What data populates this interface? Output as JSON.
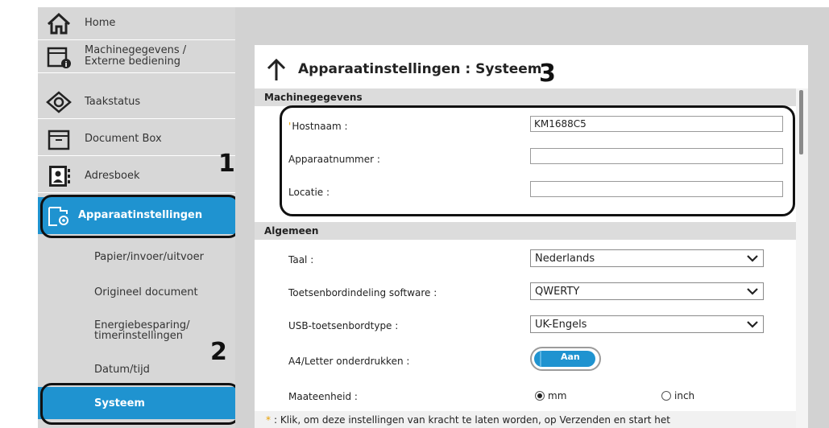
{
  "sidebar": {
    "items": [
      {
        "label": "Home",
        "icon": "home-icon"
      },
      {
        "label_line1": "Machinegegevens /",
        "label_line2": "Externe bediening",
        "icon": "machine-info-icon"
      },
      {
        "label": "Taakstatus",
        "icon": "eye-icon"
      },
      {
        "label": "Document Box",
        "icon": "document-box-icon"
      },
      {
        "label": "Adresboek",
        "icon": "address-book-icon"
      },
      {
        "label": "Apparaatinstellingen",
        "icon": "device-settings-icon",
        "active": true
      }
    ],
    "subitems": [
      {
        "label": "Papier/invoer/uitvoer"
      },
      {
        "label": "Origineel document"
      },
      {
        "label_line1": "Energiebesparing/",
        "label_line2": "timerinstellingen"
      },
      {
        "label": "Datum/tijd"
      },
      {
        "label": "Systeem",
        "active": true
      }
    ]
  },
  "callouts": {
    "n1": "1",
    "n2": "2",
    "n3": "3"
  },
  "panel": {
    "title": "Apparaatinstellingen : Systeem",
    "sections": {
      "machine": {
        "heading": "Machinegegevens",
        "hostname_label": "Hostnaam :",
        "hostname_value": "KM1688C5",
        "device_number_label": "Apparaatnummer :",
        "device_number_value": "",
        "location_label": "Locatie :",
        "location_value": ""
      },
      "general": {
        "heading": "Algemeen",
        "language_label": "Taal :",
        "language_value": "Nederlands",
        "keyboard_label": "Toetsenbordindeling software :",
        "keyboard_value": "QWERTY",
        "usb_label": "USB-toetsenbordtype :",
        "usb_value": "UK-Engels",
        "a4_label": "A4/Letter onderdrukken :",
        "a4_value": "Aan",
        "unit_label": "Maateenheid :",
        "unit_mm": "mm",
        "unit_inch": "inch",
        "unit_selected": "mm"
      }
    },
    "footer_star": "*",
    "footer_text": ": Klik, om deze instellingen van kracht te laten worden, op Verzenden en start het"
  },
  "colors": {
    "accent": "#1f93d0",
    "required": "#e8a000",
    "sidebar_bg": "#d7d7d7"
  }
}
